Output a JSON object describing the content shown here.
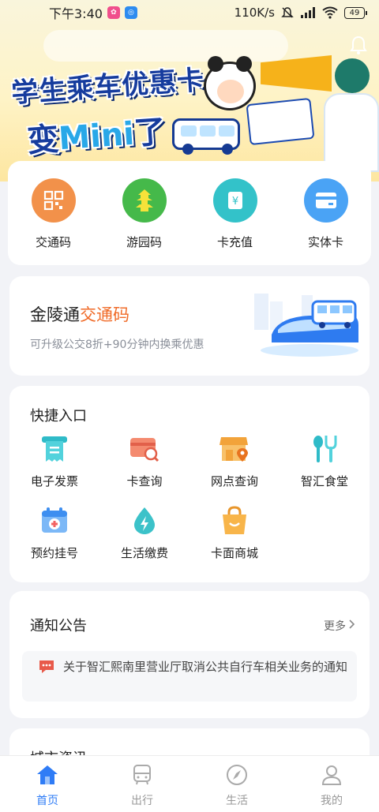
{
  "status_bar": {
    "time": "下午3:40",
    "net_speed": "110K/s",
    "battery": "49"
  },
  "banner": {
    "title_line1": "学生乘车优惠卡",
    "title_line2_prefix": "变",
    "title_line2_mini": "Mini",
    "title_line2_suffix": "了"
  },
  "top_actions": [
    {
      "label": "交通码",
      "icon": "qr-code-icon",
      "color": "#f2914a"
    },
    {
      "label": "游园码",
      "icon": "pagoda-icon",
      "color": "#45b94a"
    },
    {
      "label": "卡充值",
      "icon": "recharge-icon",
      "color": "#33c2c9"
    },
    {
      "label": "实体卡",
      "icon": "card-icon",
      "color": "#4aa3f5"
    }
  ],
  "promo": {
    "title_plain": "金陵通",
    "title_accent": "交通码",
    "subtitle": "可升级公交8折+90分钟内换乘优惠"
  },
  "quick_entry": {
    "title": "快捷入口",
    "items": [
      {
        "label": "电子发票",
        "icon": "invoice-icon"
      },
      {
        "label": "卡查询",
        "icon": "card-search-icon"
      },
      {
        "label": "网点查询",
        "icon": "shop-location-icon"
      },
      {
        "label": "智汇食堂",
        "icon": "canteen-icon"
      },
      {
        "label": "预约挂号",
        "icon": "appointment-icon"
      },
      {
        "label": "生活缴费",
        "icon": "utility-payment-icon"
      },
      {
        "label": "卡面商城",
        "icon": "shopping-bag-icon"
      }
    ]
  },
  "notice": {
    "title": "通知公告",
    "more": "更多",
    "text": "关于智汇熙南里营业厅取消公共自行车相关业务的通知"
  },
  "next_section": {
    "title": "城市资讯"
  },
  "tabs": [
    {
      "label": "首页",
      "icon": "home-icon",
      "active": true
    },
    {
      "label": "出行",
      "icon": "bus-icon",
      "active": false
    },
    {
      "label": "生活",
      "icon": "compass-icon",
      "active": false
    },
    {
      "label": "我的",
      "icon": "user-icon",
      "active": false
    }
  ],
  "colors": {
    "accent_blue": "#2f7cf6",
    "accent_orange": "#f06b28",
    "background": "#f2f3f7"
  }
}
